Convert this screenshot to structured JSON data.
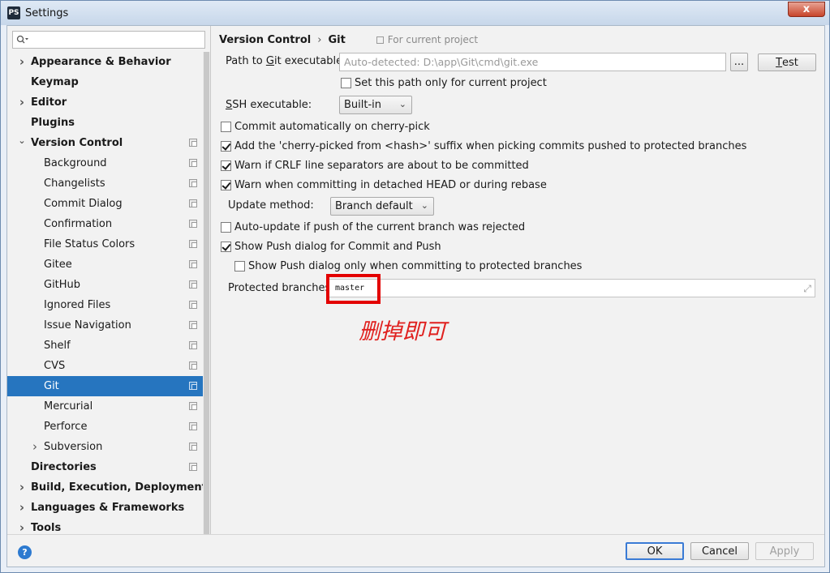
{
  "window": {
    "app_icon": "PS",
    "title": "Settings",
    "close_glyph": "x"
  },
  "sidebar": {
    "search_placeholder": "",
    "items": [
      {
        "label": "Appearance & Behavior",
        "bold": true,
        "arrow": ">",
        "level": 0
      },
      {
        "label": "Keymap",
        "bold": true,
        "arrow": "",
        "level": 0
      },
      {
        "label": "Editor",
        "bold": true,
        "arrow": ">",
        "level": 0
      },
      {
        "label": "Plugins",
        "bold": true,
        "arrow": "",
        "level": 0
      },
      {
        "label": "Version Control",
        "bold": true,
        "arrow": "v",
        "level": 0,
        "project": true
      },
      {
        "label": "Background",
        "level": 1,
        "project": true
      },
      {
        "label": "Changelists",
        "level": 1,
        "project": true
      },
      {
        "label": "Commit Dialog",
        "level": 1,
        "project": true
      },
      {
        "label": "Confirmation",
        "level": 1,
        "project": true
      },
      {
        "label": "File Status Colors",
        "level": 1,
        "project": true
      },
      {
        "label": "Gitee",
        "level": 1,
        "project": true
      },
      {
        "label": "GitHub",
        "level": 1,
        "project": true
      },
      {
        "label": "Ignored Files",
        "level": 1,
        "project": true
      },
      {
        "label": "Issue Navigation",
        "level": 1,
        "project": true
      },
      {
        "label": "Shelf",
        "level": 1,
        "project": true
      },
      {
        "label": "CVS",
        "level": 1,
        "project": true
      },
      {
        "label": "Git",
        "level": 1,
        "project": true,
        "selected": true
      },
      {
        "label": "Mercurial",
        "level": 1,
        "project": true
      },
      {
        "label": "Perforce",
        "level": 1,
        "project": true
      },
      {
        "label": "Subversion",
        "level": 1,
        "arrow": ">",
        "project": true
      },
      {
        "label": "Directories",
        "bold": true,
        "level": 0,
        "project": true
      },
      {
        "label": "Build, Execution, Deployment",
        "bold": true,
        "arrow": ">",
        "level": 0
      },
      {
        "label": "Languages & Frameworks",
        "bold": true,
        "arrow": ">",
        "level": 0
      },
      {
        "label": "Tools",
        "bold": true,
        "arrow": ">",
        "level": 0
      }
    ]
  },
  "main": {
    "breadcrumb": {
      "parent": "Version Control",
      "separator": "›",
      "current": "Git",
      "scope": "For current project"
    },
    "git_path": {
      "label_pre": "Path to ",
      "label_mnemonic": "G",
      "label_post": "it executable:",
      "placeholder": "Auto-detected: D:\\app\\Git\\cmd\\git.exe",
      "browse_label": "...",
      "test_label_mnemonic": "T",
      "test_label_rest": "est"
    },
    "set_path_project": {
      "label": "Set this path only for current project",
      "checked": false
    },
    "ssh": {
      "label_mnemonic": "S",
      "label_rest": "SH executable:",
      "value": "Built-in"
    },
    "options": [
      {
        "label": "Commit automatically on cherry-pick",
        "checked": false
      },
      {
        "label": "Add the 'cherry-picked from <hash>' suffix when picking commits pushed to protected branches",
        "checked": true
      },
      {
        "label": "Warn if CRLF line separators are about to be committed",
        "checked": true
      },
      {
        "label": "Warn when committing in detached HEAD or during rebase",
        "checked": true
      }
    ],
    "update_method": {
      "label": "Update method:",
      "value": "Branch default"
    },
    "auto_update": {
      "label": "Auto-update if push of the current branch was rejected",
      "checked": false
    },
    "show_push": {
      "label": "Show Push dialog for Commit and Push",
      "checked": true
    },
    "show_push_protected": {
      "label": "Show Push dialog only when committing to protected branches",
      "checked": false
    },
    "protected": {
      "label": "Protected branches:",
      "value": "master"
    },
    "annotation": "删掉即可"
  },
  "footer": {
    "help_glyph": "?",
    "ok_label": "OK",
    "cancel_label": "Cancel",
    "apply_label": "Apply"
  },
  "colors": {
    "selection": "#2675bf",
    "annotation_red": "#e30000"
  }
}
